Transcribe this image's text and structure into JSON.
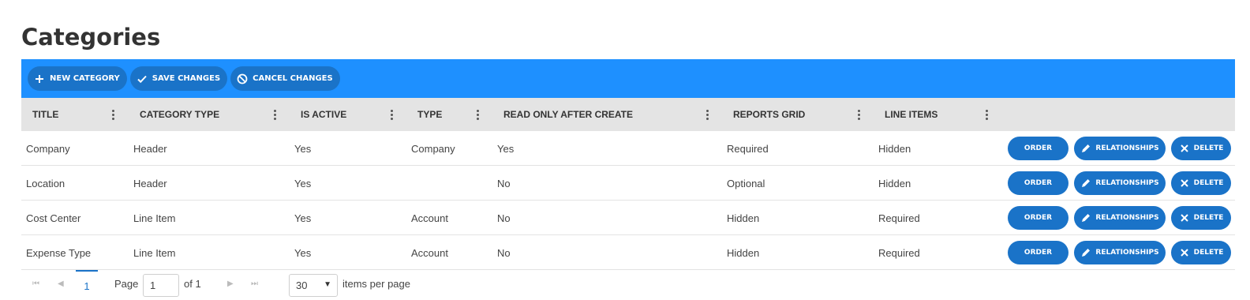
{
  "page": {
    "title": "Categories"
  },
  "toolbar": {
    "new_category": "NEW CATEGORY",
    "save_changes": "SAVE CHANGES",
    "cancel_changes": "CANCEL CHANGES",
    "background": "#1e90ff",
    "button_color": "#1a73c8"
  },
  "grid": {
    "columns": [
      "TITLE",
      "CATEGORY TYPE",
      "IS ACTIVE",
      "TYPE",
      "READ ONLY AFTER CREATE",
      "REPORTS GRID",
      "LINE ITEMS"
    ],
    "rows": [
      [
        "Company",
        "Header",
        "Yes",
        "Company",
        "Yes",
        "Required",
        "Hidden"
      ],
      [
        "Location",
        "Header",
        "Yes",
        "",
        "No",
        "Optional",
        "Hidden"
      ],
      [
        "Cost Center",
        "Line Item",
        "Yes",
        "Account",
        "No",
        "Hidden",
        "Required"
      ],
      [
        "Expense Type",
        "Line Item",
        "Yes",
        "Account",
        "No",
        "Hidden",
        "Required"
      ]
    ],
    "actions": {
      "order": "ORDER",
      "relationships": "RELATIONSHIPS",
      "delete": "DELETE"
    }
  },
  "pager": {
    "current_page_number": "1",
    "page_label": "Page",
    "page_input_value": "1",
    "of_label": "of 1",
    "page_size": "30",
    "items_per_page": "items per page"
  },
  "icons": {
    "new": "plus-icon",
    "save": "check-icon",
    "cancel": "cancel-icon",
    "relationships": "pencil-icon",
    "delete": "x-icon",
    "column_menu": "kebab-icon"
  }
}
